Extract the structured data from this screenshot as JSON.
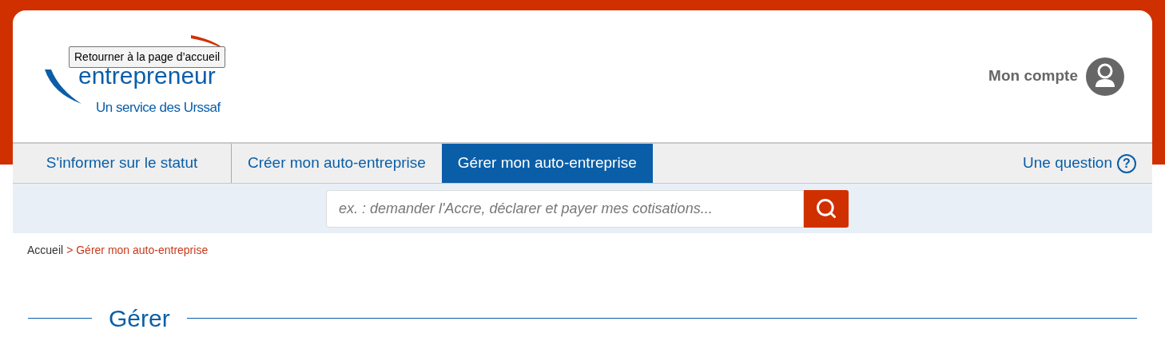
{
  "logo": {
    "line_1": "entrepreneur",
    "line_2": "Un service des Urssaf"
  },
  "tooltip": "Retourner à la page d’accueil",
  "account": {
    "label": "Mon compte"
  },
  "nav": {
    "tabs": [
      {
        "label": "S'informer sur le statut",
        "selected": false
      },
      {
        "label": "Créer mon auto-entreprise",
        "selected": false
      },
      {
        "label": "Gérer mon auto-entreprise",
        "selected": true
      }
    ],
    "question": {
      "label": "Une question",
      "icon": "?"
    }
  },
  "search": {
    "placeholder": "ex. : demander l'Accre, déclarer et payer mes cotisations..."
  },
  "breadcrumb": [
    {
      "label": "Accueil",
      "current": false
    },
    {
      "label": "> Gérer mon auto-entreprise",
      "current": true
    }
  ],
  "section_title": "Gérer"
}
